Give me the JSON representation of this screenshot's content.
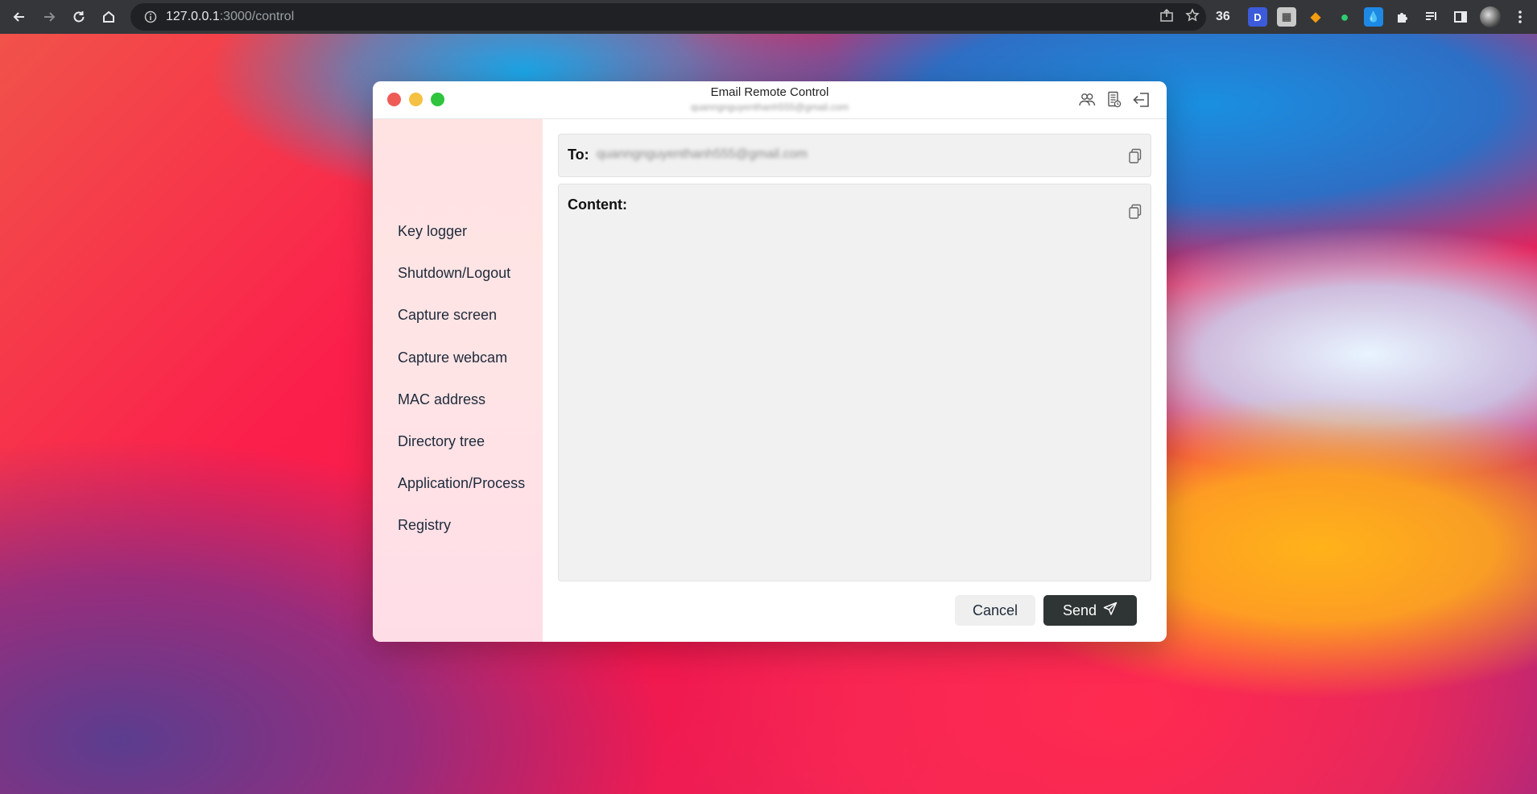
{
  "browser": {
    "url_host": "127.0.0.1",
    "url_path": ":3000/control",
    "extension_badge": "36",
    "extension_letter": "D"
  },
  "window": {
    "title": "Email Remote Control",
    "subtitle": "quanngnguyenthanh555@gmail.com"
  },
  "sidebar": {
    "items": [
      {
        "label": "Key logger"
      },
      {
        "label": "Shutdown/Logout"
      },
      {
        "label": "Capture screen"
      },
      {
        "label": "Capture webcam"
      },
      {
        "label": "MAC address"
      },
      {
        "label": "Directory tree"
      },
      {
        "label": "Application/Process"
      },
      {
        "label": "Registry"
      }
    ]
  },
  "compose": {
    "to_label": "To:",
    "to_value": "quanngnguyenthanh555@gmail.com",
    "content_label": "Content:",
    "content_value": ""
  },
  "actions": {
    "cancel_label": "Cancel",
    "send_label": "Send"
  },
  "colors": {
    "send_button": "#2f3434",
    "cancel_button": "#efefef",
    "sidebar_bg": "#ffe3e3",
    "close": "#ee5b57",
    "minimize": "#f5c142",
    "maximize": "#2fc43b"
  }
}
